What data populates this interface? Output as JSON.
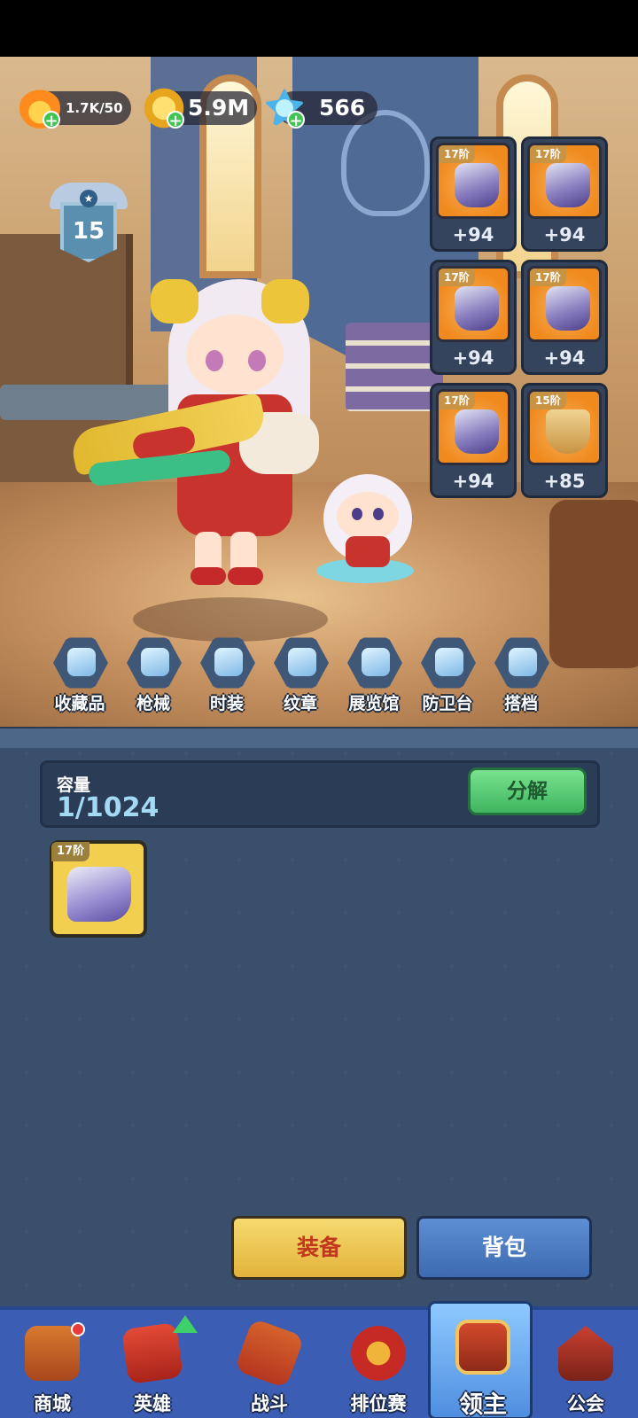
{
  "resources": {
    "energy": "1.7K/50",
    "gold": "5.9M",
    "gems": "566"
  },
  "level": "15",
  "equipment": [
    {
      "grade": "17阶",
      "bonus": "+94",
      "icon": "helmet-icon"
    },
    {
      "grade": "17阶",
      "bonus": "+94",
      "icon": "armor-icon"
    },
    {
      "grade": "17阶",
      "bonus": "+94",
      "icon": "boots-icon"
    },
    {
      "grade": "17阶",
      "bonus": "+94",
      "icon": "gauntlet-icon"
    },
    {
      "grade": "17阶",
      "bonus": "+94",
      "icon": "shoulder-icon"
    },
    {
      "grade": "15阶",
      "bonus": "+85",
      "icon": "skirt-icon"
    }
  ],
  "menu": [
    {
      "label": "收藏品",
      "icon": "feather-icon"
    },
    {
      "label": "枪械",
      "icon": "gun-icon"
    },
    {
      "label": "时装",
      "icon": "outfit-icon"
    },
    {
      "label": "纹章",
      "icon": "crest-icon"
    },
    {
      "label": "展览馆",
      "icon": "museum-icon"
    },
    {
      "label": "防卫台",
      "icon": "tower-icon"
    },
    {
      "label": "搭档",
      "icon": "partner-icon"
    }
  ],
  "inventory": {
    "capacity_label": "容量",
    "capacity_value": "1/1024",
    "decompose_label": "分解",
    "items": [
      {
        "grade": "17阶",
        "icon": "boots-icon"
      }
    ]
  },
  "actions": {
    "equip_label": "装备",
    "bag_label": "背包"
  },
  "nav": [
    {
      "label": "商城",
      "icon": "shop-icon"
    },
    {
      "label": "英雄",
      "icon": "hero-icon"
    },
    {
      "label": "战斗",
      "icon": "battle-icon"
    },
    {
      "label": "排位赛",
      "icon": "rank-icon"
    },
    {
      "label": "领主",
      "icon": "lord-icon",
      "active": true
    },
    {
      "label": "公会",
      "icon": "guild-icon"
    }
  ],
  "colors": {
    "gold_tile": "#f2cf4e",
    "orange_tile": "#f08a1e",
    "nav_bg": "#3b5eb4",
    "panel_bg": "#3a4f6c"
  }
}
